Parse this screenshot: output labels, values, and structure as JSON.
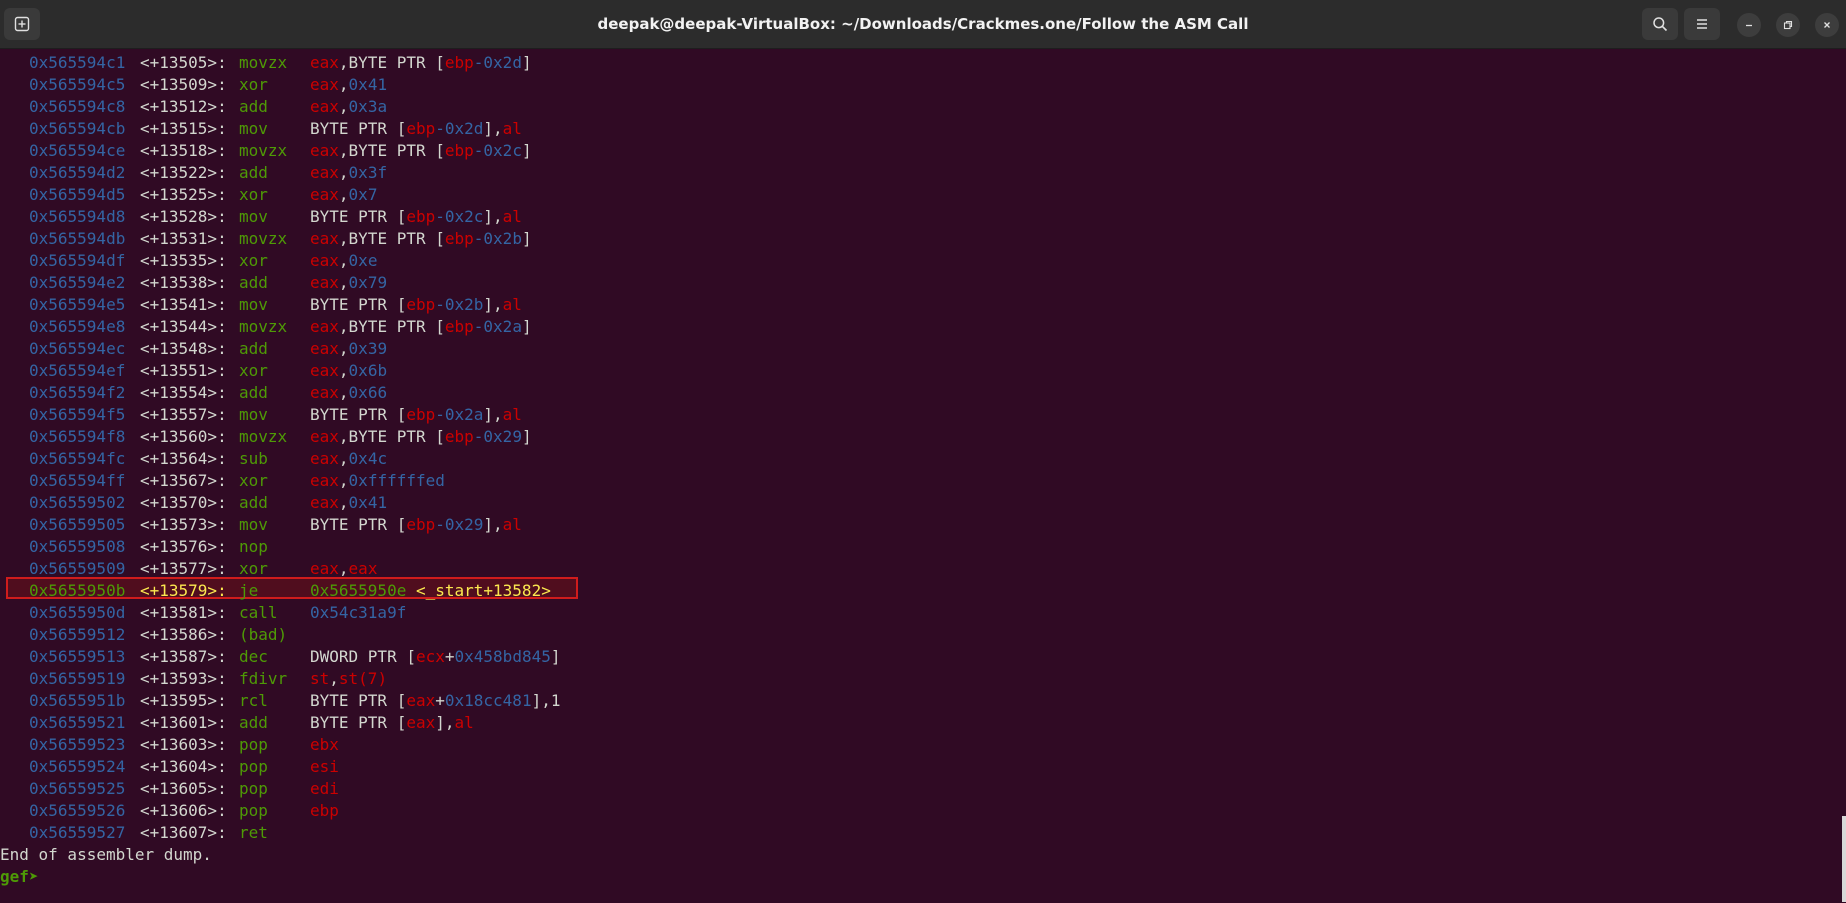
{
  "window": {
    "title": "deepak@deepak-VirtualBox: ~/Downloads/Crackmes.one/Follow the ASM Call"
  },
  "lines": [
    {
      "addr": "0x565594c1",
      "off": "<+13505>:",
      "mn": "movzx",
      "ops": [
        [
          "reg",
          "eax"
        ],
        [
          "t",
          ",BYTE PTR ["
        ],
        [
          "reg",
          "ebp"
        ],
        [
          "num",
          "-0x2d"
        ],
        [
          "t",
          "]"
        ]
      ]
    },
    {
      "addr": "0x565594c5",
      "off": "<+13509>:",
      "mn": "xor",
      "ops": [
        [
          "reg",
          "eax"
        ],
        [
          "t",
          ","
        ],
        [
          "num",
          "0x41"
        ]
      ]
    },
    {
      "addr": "0x565594c8",
      "off": "<+13512>:",
      "mn": "add",
      "ops": [
        [
          "reg",
          "eax"
        ],
        [
          "t",
          ","
        ],
        [
          "num",
          "0x3a"
        ]
      ]
    },
    {
      "addr": "0x565594cb",
      "off": "<+13515>:",
      "mn": "mov",
      "ops": [
        [
          "t",
          "BYTE PTR ["
        ],
        [
          "reg",
          "ebp"
        ],
        [
          "num",
          "-0x2d"
        ],
        [
          "t",
          "],"
        ],
        [
          "reg",
          "al"
        ]
      ]
    },
    {
      "addr": "0x565594ce",
      "off": "<+13518>:",
      "mn": "movzx",
      "ops": [
        [
          "reg",
          "eax"
        ],
        [
          "t",
          ",BYTE PTR ["
        ],
        [
          "reg",
          "ebp"
        ],
        [
          "num",
          "-0x2c"
        ],
        [
          "t",
          "]"
        ]
      ]
    },
    {
      "addr": "0x565594d2",
      "off": "<+13522>:",
      "mn": "add",
      "ops": [
        [
          "reg",
          "eax"
        ],
        [
          "t",
          ","
        ],
        [
          "num",
          "0x3f"
        ]
      ]
    },
    {
      "addr": "0x565594d5",
      "off": "<+13525>:",
      "mn": "xor",
      "ops": [
        [
          "reg",
          "eax"
        ],
        [
          "t",
          ","
        ],
        [
          "num",
          "0x7"
        ]
      ]
    },
    {
      "addr": "0x565594d8",
      "off": "<+13528>:",
      "mn": "mov",
      "ops": [
        [
          "t",
          "BYTE PTR ["
        ],
        [
          "reg",
          "ebp"
        ],
        [
          "num",
          "-0x2c"
        ],
        [
          "t",
          "],"
        ],
        [
          "reg",
          "al"
        ]
      ]
    },
    {
      "addr": "0x565594db",
      "off": "<+13531>:",
      "mn": "movzx",
      "ops": [
        [
          "reg",
          "eax"
        ],
        [
          "t",
          ",BYTE PTR ["
        ],
        [
          "reg",
          "ebp"
        ],
        [
          "num",
          "-0x2b"
        ],
        [
          "t",
          "]"
        ]
      ]
    },
    {
      "addr": "0x565594df",
      "off": "<+13535>:",
      "mn": "xor",
      "ops": [
        [
          "reg",
          "eax"
        ],
        [
          "t",
          ","
        ],
        [
          "num",
          "0xe"
        ]
      ]
    },
    {
      "addr": "0x565594e2",
      "off": "<+13538>:",
      "mn": "add",
      "ops": [
        [
          "reg",
          "eax"
        ],
        [
          "t",
          ","
        ],
        [
          "num",
          "0x79"
        ]
      ]
    },
    {
      "addr": "0x565594e5",
      "off": "<+13541>:",
      "mn": "mov",
      "ops": [
        [
          "t",
          "BYTE PTR ["
        ],
        [
          "reg",
          "ebp"
        ],
        [
          "num",
          "-0x2b"
        ],
        [
          "t",
          "],"
        ],
        [
          "reg",
          "al"
        ]
      ]
    },
    {
      "addr": "0x565594e8",
      "off": "<+13544>:",
      "mn": "movzx",
      "ops": [
        [
          "reg",
          "eax"
        ],
        [
          "t",
          ",BYTE PTR ["
        ],
        [
          "reg",
          "ebp"
        ],
        [
          "num",
          "-0x2a"
        ],
        [
          "t",
          "]"
        ]
      ]
    },
    {
      "addr": "0x565594ec",
      "off": "<+13548>:",
      "mn": "add",
      "ops": [
        [
          "reg",
          "eax"
        ],
        [
          "t",
          ","
        ],
        [
          "num",
          "0x39"
        ]
      ]
    },
    {
      "addr": "0x565594ef",
      "off": "<+13551>:",
      "mn": "xor",
      "ops": [
        [
          "reg",
          "eax"
        ],
        [
          "t",
          ","
        ],
        [
          "num",
          "0x6b"
        ]
      ]
    },
    {
      "addr": "0x565594f2",
      "off": "<+13554>:",
      "mn": "add",
      "ops": [
        [
          "reg",
          "eax"
        ],
        [
          "t",
          ","
        ],
        [
          "num",
          "0x66"
        ]
      ]
    },
    {
      "addr": "0x565594f5",
      "off": "<+13557>:",
      "mn": "mov",
      "ops": [
        [
          "t",
          "BYTE PTR ["
        ],
        [
          "reg",
          "ebp"
        ],
        [
          "num",
          "-0x2a"
        ],
        [
          "t",
          "],"
        ],
        [
          "reg",
          "al"
        ]
      ]
    },
    {
      "addr": "0x565594f8",
      "off": "<+13560>:",
      "mn": "movzx",
      "ops": [
        [
          "reg",
          "eax"
        ],
        [
          "t",
          ",BYTE PTR ["
        ],
        [
          "reg",
          "ebp"
        ],
        [
          "num",
          "-0x29"
        ],
        [
          "t",
          "]"
        ]
      ]
    },
    {
      "addr": "0x565594fc",
      "off": "<+13564>:",
      "mn": "sub",
      "ops": [
        [
          "reg",
          "eax"
        ],
        [
          "t",
          ","
        ],
        [
          "num",
          "0x4c"
        ]
      ]
    },
    {
      "addr": "0x565594ff",
      "off": "<+13567>:",
      "mn": "xor",
      "ops": [
        [
          "reg",
          "eax"
        ],
        [
          "t",
          ","
        ],
        [
          "num",
          "0xffffffed"
        ]
      ]
    },
    {
      "addr": "0x56559502",
      "off": "<+13570>:",
      "mn": "add",
      "ops": [
        [
          "reg",
          "eax"
        ],
        [
          "t",
          ","
        ],
        [
          "num",
          "0x41"
        ]
      ]
    },
    {
      "addr": "0x56559505",
      "off": "<+13573>:",
      "mn": "mov",
      "ops": [
        [
          "t",
          "BYTE PTR ["
        ],
        [
          "reg",
          "ebp"
        ],
        [
          "num",
          "-0x29"
        ],
        [
          "t",
          "],"
        ],
        [
          "reg",
          "al"
        ]
      ]
    },
    {
      "addr": "0x56559508",
      "off": "<+13576>:",
      "mn": "nop",
      "ops": []
    },
    {
      "addr": "0x56559509",
      "off": "<+13577>:",
      "mn": "xor",
      "ops": [
        [
          "reg",
          "eax"
        ],
        [
          "t",
          ","
        ],
        [
          "reg",
          "eax"
        ]
      ]
    },
    {
      "addr": "0x5655950b",
      "off": "<+13579>:",
      "mn": "je",
      "ops": [
        [
          "num",
          "0x5655950e"
        ],
        [
          "t",
          " "
        ],
        [
          "sym",
          "<_start+13582>"
        ]
      ],
      "highlight": true
    },
    {
      "addr": "0x5655950d",
      "off": "<+13581>:",
      "mn": "call",
      "ops": [
        [
          "num",
          "0x54c31a9f"
        ]
      ]
    },
    {
      "addr": "0x56559512",
      "off": "<+13586>:",
      "mn": "(bad)",
      "ops": []
    },
    {
      "addr": "0x56559513",
      "off": "<+13587>:",
      "mn": "dec",
      "ops": [
        [
          "t",
          "DWORD PTR ["
        ],
        [
          "reg",
          "ecx"
        ],
        [
          "t",
          "+"
        ],
        [
          "num",
          "0x458bd845"
        ],
        [
          "t",
          "]"
        ]
      ]
    },
    {
      "addr": "0x56559519",
      "off": "<+13593>:",
      "mn": "fdivr",
      "ops": [
        [
          "reg",
          "st"
        ],
        [
          "t",
          ","
        ],
        [
          "reg",
          "st(7)"
        ]
      ]
    },
    {
      "addr": "0x5655951b",
      "off": "<+13595>:",
      "mn": "rcl",
      "ops": [
        [
          "t",
          "BYTE PTR ["
        ],
        [
          "reg",
          "eax"
        ],
        [
          "t",
          "+"
        ],
        [
          "num",
          "0x18cc481"
        ],
        [
          "t",
          "],1"
        ]
      ]
    },
    {
      "addr": "0x56559521",
      "off": "<+13601>:",
      "mn": "add",
      "ops": [
        [
          "t",
          "BYTE PTR ["
        ],
        [
          "reg",
          "eax"
        ],
        [
          "t",
          "],"
        ],
        [
          "reg",
          "al"
        ]
      ]
    },
    {
      "addr": "0x56559523",
      "off": "<+13603>:",
      "mn": "pop",
      "ops": [
        [
          "reg",
          "ebx"
        ]
      ]
    },
    {
      "addr": "0x56559524",
      "off": "<+13604>:",
      "mn": "pop",
      "ops": [
        [
          "reg",
          "esi"
        ]
      ]
    },
    {
      "addr": "0x56559525",
      "off": "<+13605>:",
      "mn": "pop",
      "ops": [
        [
          "reg",
          "edi"
        ]
      ]
    },
    {
      "addr": "0x56559526",
      "off": "<+13606>:",
      "mn": "pop",
      "ops": [
        [
          "reg",
          "ebp"
        ]
      ]
    },
    {
      "addr": "0x56559527",
      "off": "<+13607>:",
      "mn": "ret",
      "ops": []
    }
  ],
  "end_text": "End of assembler dump.",
  "prompt": "gef➤ "
}
